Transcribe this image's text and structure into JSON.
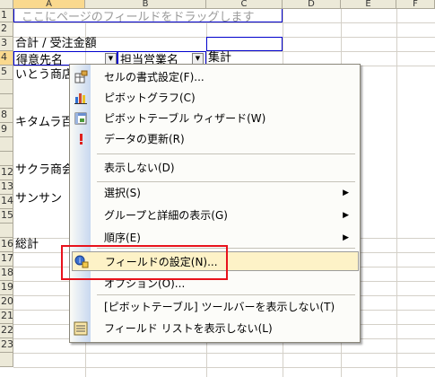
{
  "columns": [
    "A",
    "B",
    "C",
    "D",
    "E",
    "F"
  ],
  "rows": [
    "1",
    "2",
    "3",
    "4",
    "5",
    "6",
    "7",
    "8",
    "9",
    "10",
    "11",
    "12",
    "13",
    "14",
    "15",
    "16",
    "17",
    "18",
    "19",
    "20",
    "21",
    "22",
    "23"
  ],
  "sheet": {
    "page_drop_zone": "ここにページのフィールドをドラッグします",
    "data_field": "合計 / 受注金額",
    "row_field": "得意先名",
    "column_field": "担当営業名",
    "total_header": "集計",
    "customers": [
      "いとう商店",
      "キタムラ百",
      "サクラ商会",
      "サンサン"
    ],
    "grand_total": "総計"
  },
  "context_menu": {
    "items": [
      {
        "label": "セルの書式設定(F)...",
        "icon": "format-cells-icon"
      },
      {
        "label": "ピボットグラフ(C)",
        "icon": "pivot-chart-icon"
      },
      {
        "label": "ピボットテーブル ウィザード(W)",
        "icon": "pivot-wizard-icon"
      },
      {
        "label": "データの更新(R)",
        "icon": "refresh-data-icon"
      },
      {
        "label": "表示しない(D)",
        "icon": ""
      },
      {
        "label": "選択(S)",
        "icon": ""
      },
      {
        "label": "グループと詳細の表示(G)",
        "icon": ""
      },
      {
        "label": "順序(E)",
        "icon": ""
      },
      {
        "label": "フィールドの設定(N)...",
        "icon": "field-settings-icon"
      },
      {
        "label": "オプション(O)...",
        "icon": ""
      },
      {
        "label": "[ピボットテーブル] ツールバーを表示しない(T)",
        "icon": ""
      },
      {
        "label": "フィールド リストを表示しない(L)",
        "icon": "field-list-icon"
      }
    ]
  },
  "colors": {
    "highlight_border": "#e8121c",
    "selected_header": "#fad98e"
  }
}
